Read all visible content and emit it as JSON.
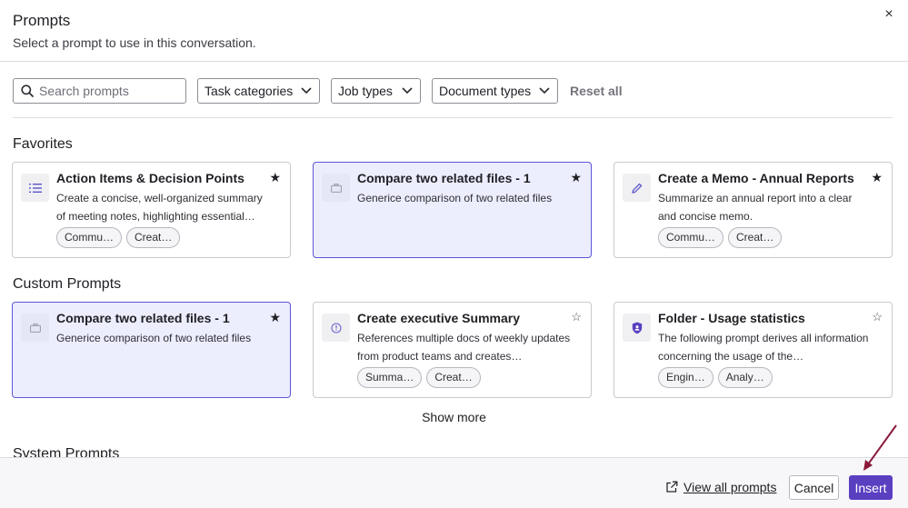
{
  "dialog": {
    "title": "Prompts",
    "subtitle": "Select a prompt to use in this conversation.",
    "close_icon": "×"
  },
  "filters": {
    "search_placeholder": "Search prompts",
    "search_value": "",
    "task_categories": "Task categories",
    "job_types": "Job types",
    "document_types": "Document types",
    "reset_all": "Reset all"
  },
  "favorites": {
    "title": "Favorites",
    "cards": [
      {
        "title": "Action Items & Decision Points",
        "description": "Create a concise, well-organized summary of meeting notes, highlighting essential…",
        "icon": "list-icon",
        "starred": true,
        "selected": false,
        "tags": [
          "Commu…",
          "Creat…"
        ]
      },
      {
        "title": "Compare two related files - 1",
        "description": "Generice comparison of two related files",
        "icon": "briefcase-icon",
        "starred": true,
        "selected": true,
        "tags": []
      },
      {
        "title": "Create a Memo - Annual Reports",
        "description": "Summarize an annual report into a clear and concise memo.",
        "icon": "pencil-icon",
        "starred": true,
        "selected": false,
        "tags": [
          "Commu…",
          "Creat…"
        ]
      }
    ]
  },
  "custom": {
    "title": "Custom Prompts",
    "cards": [
      {
        "title": "Compare two related files - 1",
        "description": "Generice comparison of two related files",
        "icon": "briefcase-icon",
        "starred": true,
        "selected": true,
        "tags": []
      },
      {
        "title": "Create executive Summary",
        "description": "References multiple docs of weekly updates from product teams and creates…",
        "icon": "info-circle-icon",
        "starred": false,
        "selected": false,
        "tags": [
          "Summa…",
          "Creat…"
        ]
      },
      {
        "title": "Folder - Usage statistics",
        "description": "The following prompt derives all information concerning the usage of the…",
        "icon": "shield-icon",
        "starred": false,
        "selected": false,
        "tags": [
          "Engin…",
          "Analy…"
        ]
      }
    ]
  },
  "show_more": "Show more",
  "system": {
    "title": "System Prompts"
  },
  "footer": {
    "view_all": "View all prompts",
    "cancel": "Cancel",
    "insert": "Insert"
  },
  "colors": {
    "accent": "#5a3fc0",
    "selected_bg": "#ecedfd",
    "selected_border": "#5b55d6",
    "annotation_arrow": "#8b1a3a"
  }
}
